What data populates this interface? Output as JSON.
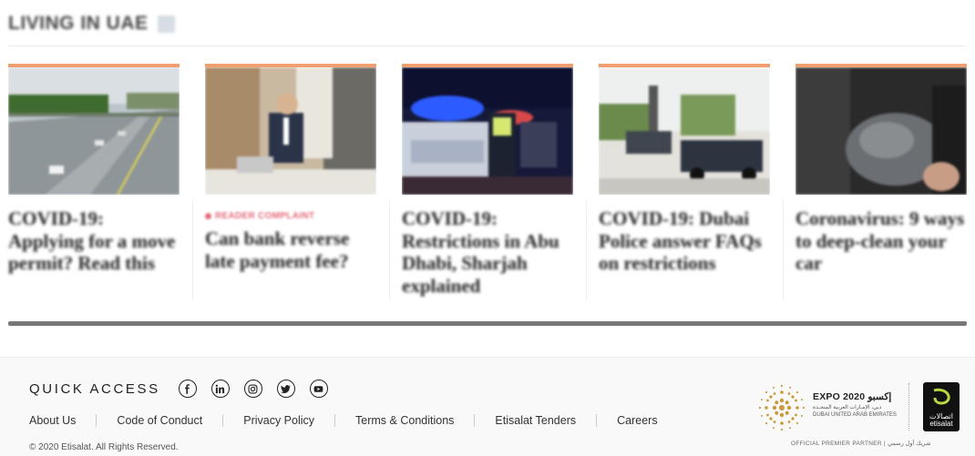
{
  "section": {
    "title": "LIVING IN UAE"
  },
  "cards": [
    {
      "kicker": "",
      "headline": "COVID-19: Applying for a move permit? Read this"
    },
    {
      "kicker": "READER COMPLAINT",
      "headline": "Can bank reverse late payment fee?"
    },
    {
      "kicker": "",
      "headline": "COVID-19: Restrictions in Abu Dhabi, Sharjah explained"
    },
    {
      "kicker": "",
      "headline": "COVID-19: Dubai Police answer FAQs on restrictions"
    },
    {
      "kicker": "",
      "headline": "Coronavirus: 9 ways to deep-clean your car"
    }
  ],
  "footer": {
    "quick_access": "QUICK ACCESS",
    "social": [
      "facebook-icon",
      "linkedin-icon",
      "instagram-icon",
      "twitter-icon",
      "youtube-icon"
    ],
    "links": [
      "About Us",
      "Code of Conduct",
      "Privacy Policy",
      "Terms & Conditions",
      "Etisalat Tenders",
      "Careers"
    ],
    "copyright": "© 2020 Etisalat. All Rights Reserved.",
    "expo_title": "EXPO 2020 إكسبو",
    "expo_sub_ar": "دبي، الإمـارات العربية المتحـدة",
    "expo_sub_en": "DUBAI UNITED ARAB EMIRATES",
    "etisalat_ar": "اتصالات",
    "etisalat_en": "etisalat",
    "partner_caption": "OFFICIAL PREMIER PARTNER | شريك أول رسمي"
  }
}
